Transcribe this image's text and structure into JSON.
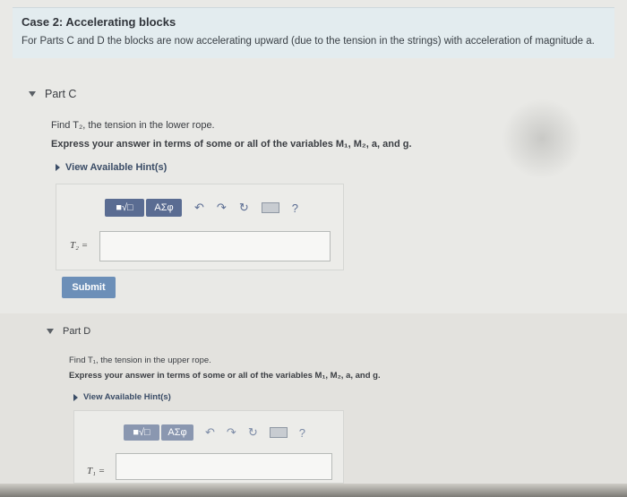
{
  "case": {
    "title": "Case 2: Accelerating blocks",
    "description": "For Parts C and D the blocks are now accelerating upward (due to the tension in the strings) with acceleration of magnitude a."
  },
  "partC": {
    "label": "Part C",
    "find": "Find T₂, the tension in the lower rope.",
    "express": "Express your answer in terms of some or all of the variables M₁, M₂, a, and g.",
    "hint": "View Available Hint(s)",
    "toolbar": {
      "template": "■√□",
      "greek": "ΑΣφ",
      "undo": "↶",
      "redo": "↷",
      "reset": "↻",
      "help": "?"
    },
    "var_label": "T₂ =",
    "submit": "Submit"
  },
  "partD": {
    "label": "Part D",
    "find": "Find T₁, the tension in the upper rope.",
    "express": "Express your answer in terms of some or all of the variables M₁, M₂, a, and g.",
    "hint": "View Available Hint(s)",
    "toolbar": {
      "template": "■√□",
      "greek": "ΑΣφ",
      "undo": "↶",
      "redo": "↷",
      "reset": "↻",
      "help": "?"
    },
    "var_label": "T₁ ="
  }
}
